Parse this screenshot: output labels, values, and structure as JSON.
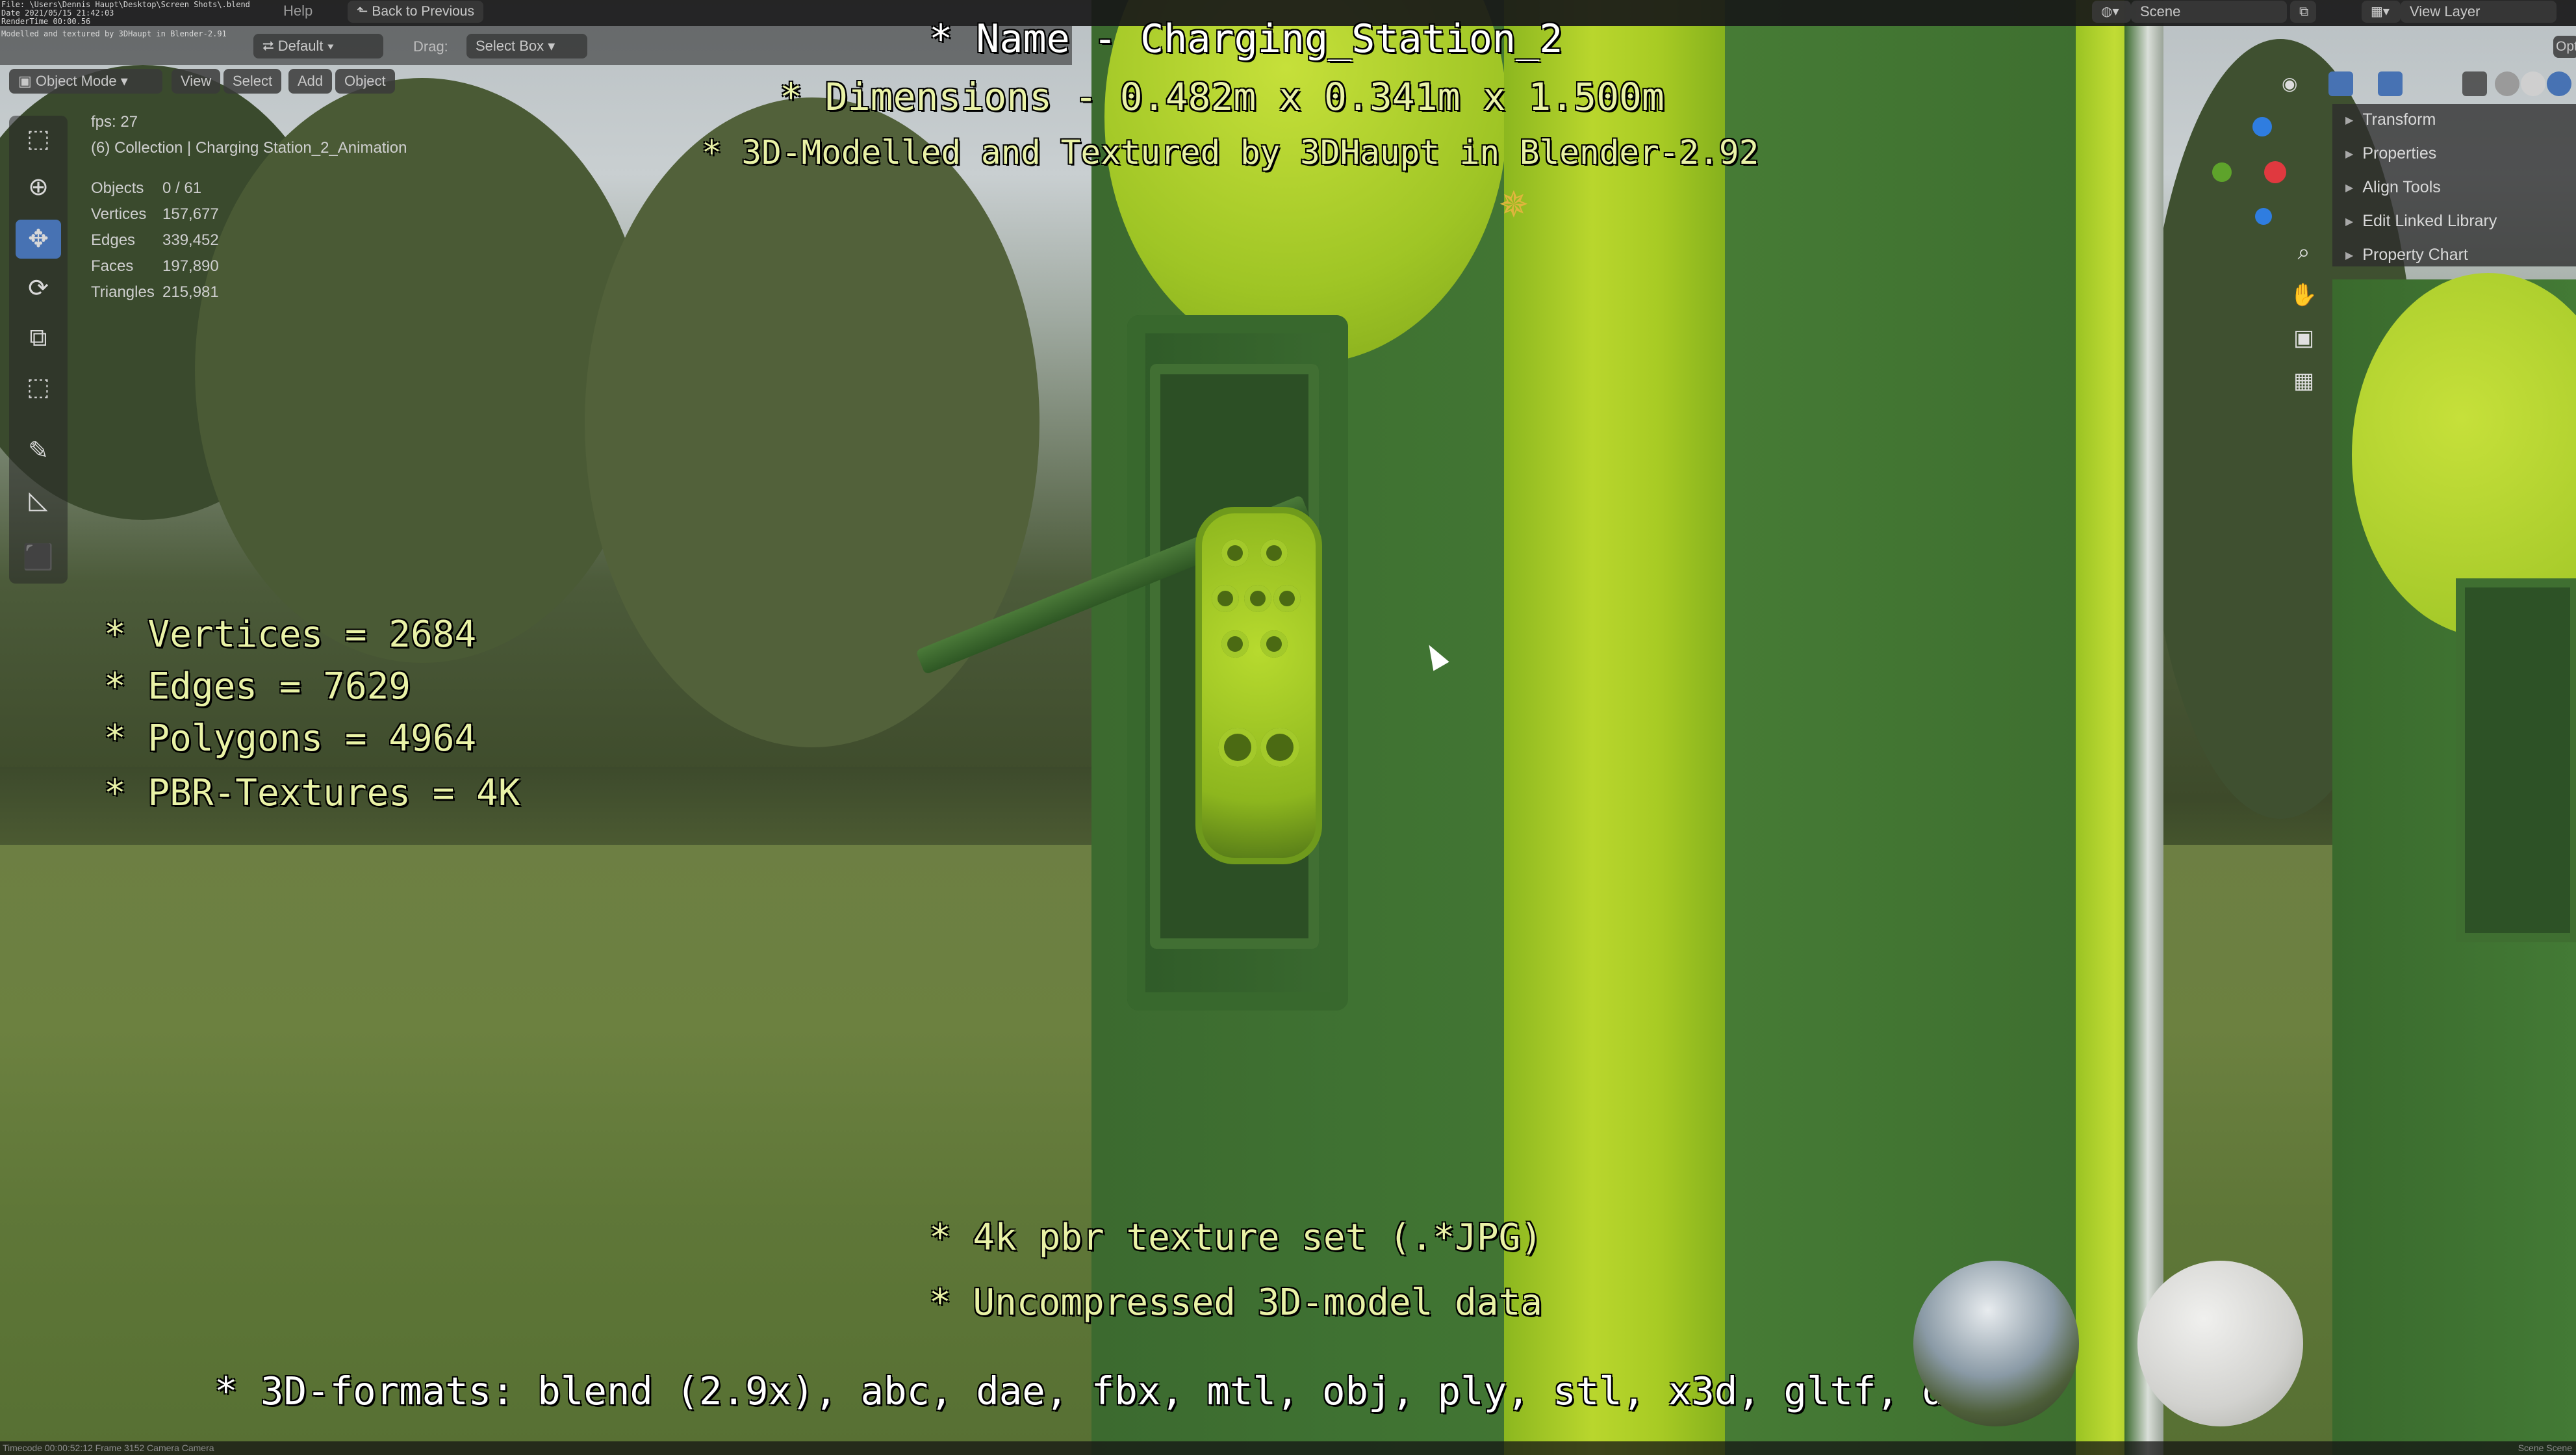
{
  "window": {
    "file_info_lines": [
      "File: \\Users\\Dennis Haupt\\Desktop\\Screen Shots\\.blend",
      "Date 2021/05/15 21:42:03",
      "RenderTime 00:00.56",
      "Modelled and textured by 3DHaupt in Blender-2.91"
    ],
    "menu": [
      "Help"
    ],
    "back_button": "Back to Previous",
    "scene_label": "Scene",
    "view_layer_label": "View Layer",
    "options_label": "Opt"
  },
  "toolbar": {
    "orientation": "Default",
    "drag_label": "Drag:",
    "drag_value": "Select Box"
  },
  "header": {
    "mode": "Object Mode",
    "menus": [
      "View",
      "Select",
      "Add",
      "Object"
    ]
  },
  "viewport_info": {
    "fps": "fps: 27",
    "collection": "(6) Collection | Charging Station_2_Animation",
    "stats": [
      {
        "key": "Objects",
        "value": "0 / 61"
      },
      {
        "key": "Vertices",
        "value": "157,677"
      },
      {
        "key": "Edges",
        "value": "339,452"
      },
      {
        "key": "Faces",
        "value": "197,890"
      },
      {
        "key": "Triangles",
        "value": "215,981"
      }
    ]
  },
  "sidebar_panels": [
    "Transform",
    "Properties",
    "Align Tools",
    "Edit Linked Library",
    "Property Chart"
  ],
  "overlay": {
    "name_line": "* Name - Charging_Station_2",
    "dimensions_line": "* Dimensions -  0.482m x 0.341m x 1.500m",
    "modelled_line": "* 3D-Modelled and Textured by 3DHaupt in Blender-2.92",
    "vertices_line": "* Vertices = 2684",
    "edges_line": "* Edges = 7629",
    "polygons_line": "* Polygons = 4964",
    "textures_line": "* PBR-Textures = 4K",
    "pbr_set_line": "* 4k pbr texture set (.*JPG)",
    "uncompressed_line": "* Uncompressed 3D-model data",
    "formats_line": "* 3D-formats: blend (2.9x), abc, dae, fbx, mtl, obj, ply, stl, x3d, gltf, dxf"
  },
  "status_bar": {
    "left": "Timecode 00:00:52:12   Frame 3152   Camera Camera",
    "right": "Scene Scene"
  },
  "colors": {
    "station_green": "#3f7232",
    "station_lime": "#b9d62d",
    "active_tool": "#4772b3",
    "overlay_yellow": "#e9f2a6"
  }
}
